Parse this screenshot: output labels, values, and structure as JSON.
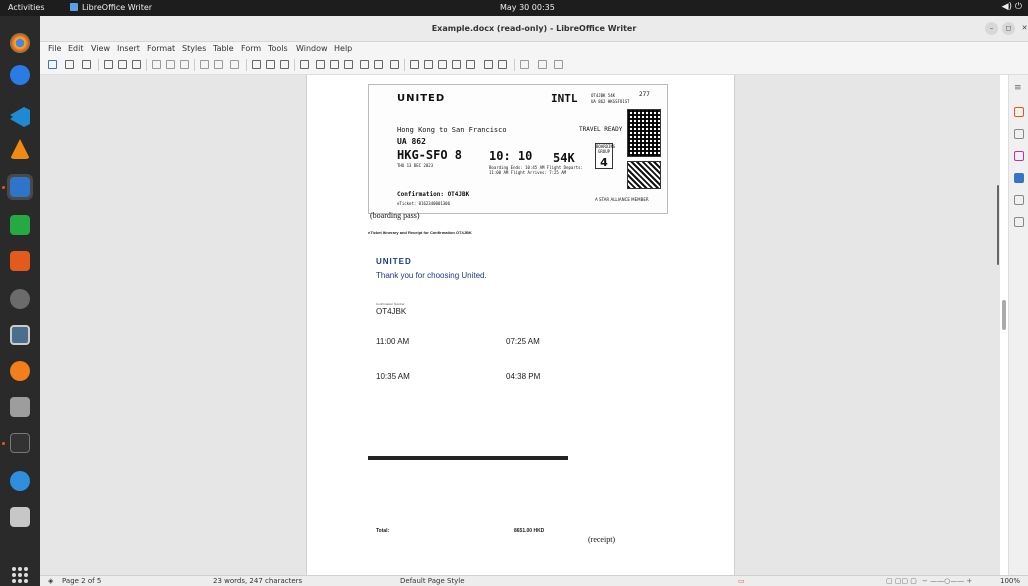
{
  "topbar": {
    "activities": "Activities",
    "app_name": "LibreOffice Writer",
    "clock": "May 30  00:35"
  },
  "window": {
    "title": "Example.docx (read-only) - LibreOffice Writer"
  },
  "menu": [
    "File",
    "Edit",
    "View",
    "Insert",
    "Format",
    "Styles",
    "Table",
    "Form",
    "Tools",
    "Window",
    "Help"
  ],
  "dock": {
    "items": [
      "chrome-icon",
      "thunderbird-icon",
      "vscode-icon",
      "vlc-icon",
      "writer-icon",
      "calc-icon",
      "impress-icon",
      "gimp-icon",
      "image-viewer-icon",
      "blender-icon",
      "files-icon",
      "terminal-icon",
      "help-icon",
      "trash-icon"
    ]
  },
  "boarding_pass": {
    "logo": "UNITED",
    "class": "INTL",
    "ref_top": "OT4JBK  54K",
    "ref_num": "277",
    "ref_sub": "UA 862  HKGSFO1ST",
    "route": "Hong Kong to San Francisco",
    "travel_ready": "TRAVEL READY",
    "flight": "UA 862",
    "pair": "HKG-SFO 8",
    "boarding": "10: 10",
    "seat": "54K",
    "group_label": "BOARDING GROUP",
    "group": "4",
    "date": "THU 13 DEC 2023",
    "times": "Boarding Ends: 10:45 AM  Flight Departs: 11:00 AM  Flight Arrives: 7:25 AM",
    "confirmation": "Confirmation: OT4JBK",
    "eticket": "eTicket: 0162340001306",
    "star": "A STAR ALLIANCE MEMBER"
  },
  "captions": {
    "boarding_pass": "(boarding pass)",
    "receipt": "(receipt)"
  },
  "receipt": {
    "header": "eTicket Itinerary and Receipt for Confirmation OT4JBK",
    "logo": "UNITED",
    "thanks": "Thank you for choosing United.",
    "confirmation_label": "Confirmation Number:",
    "confirmation": "OT4JBK",
    "dep1": "11:00 AM",
    "arr1": "07:25 AM",
    "dep2": "10:35 AM",
    "arr2": "04:38 PM",
    "total_label": "Total:",
    "total": "8651.00 HKD"
  },
  "status": {
    "page": "Page 2 of 5",
    "words": "23 words, 247 characters",
    "style": "Default Page Style",
    "zoom": "100%"
  }
}
